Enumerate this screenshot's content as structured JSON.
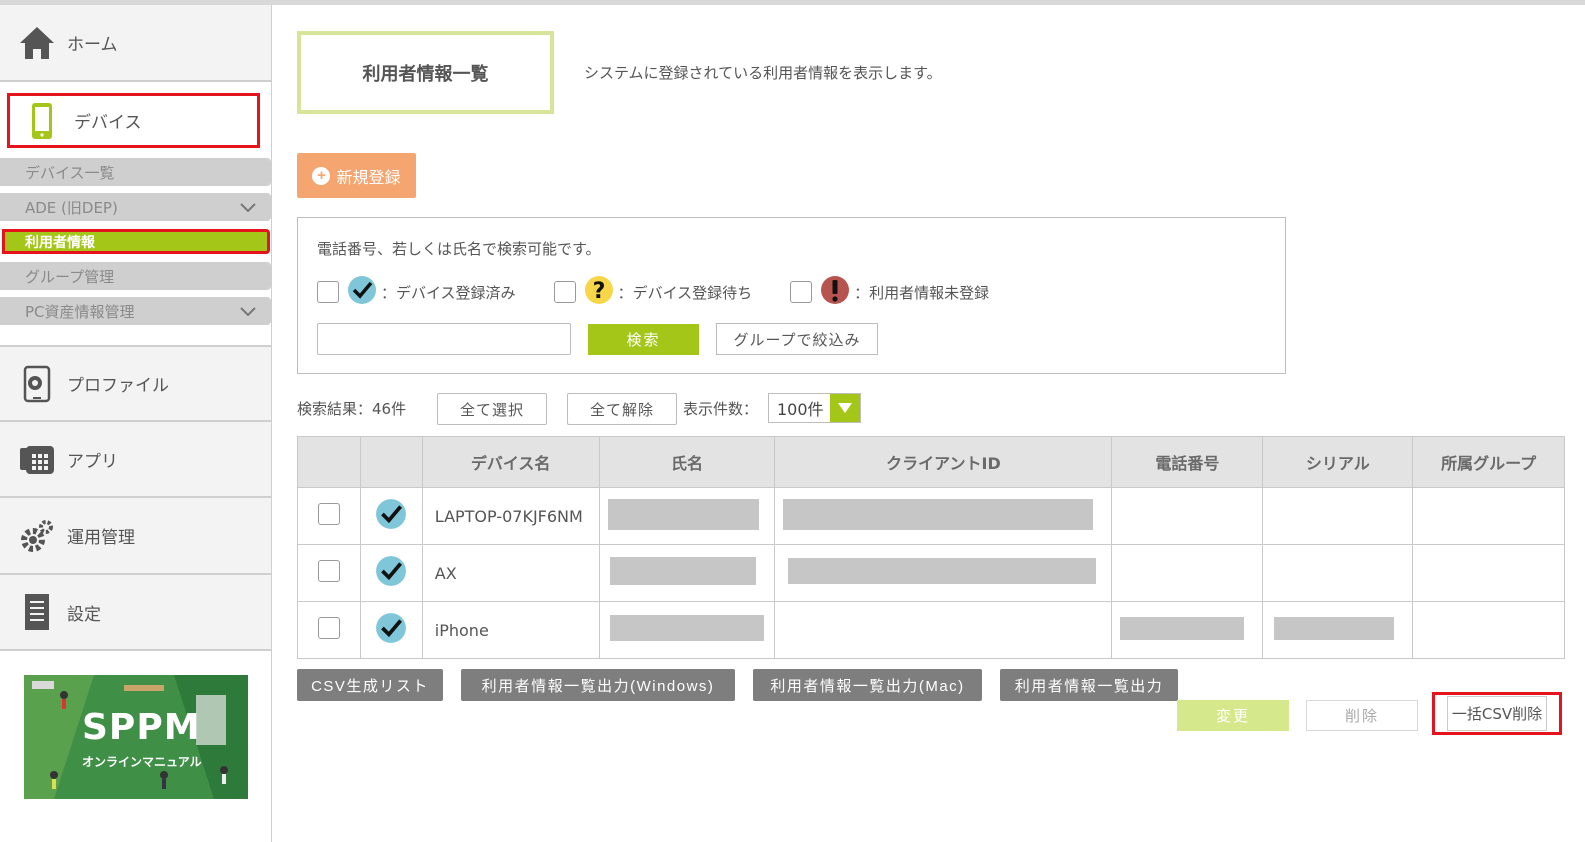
{
  "sidebar": {
    "home": "ホーム",
    "device": "デバイス",
    "sub": [
      {
        "label": "デバイス一覧",
        "expand": false
      },
      {
        "label": "ADE (旧DEP)",
        "expand": true
      },
      {
        "label": "利用者情報",
        "expand": false,
        "active": true
      },
      {
        "label": "グループ管理",
        "expand": false
      },
      {
        "label": "PC資産情報管理",
        "expand": true
      }
    ],
    "profile": "プロファイル",
    "app": "アプリ",
    "ops": "運用管理",
    "settings": "設定",
    "banner": {
      "logo": "SPPM",
      "caption": "オンラインマニュアル"
    }
  },
  "page": {
    "title": "利用者情報一覧",
    "description": "システムに登録されている利用者情報を表示します。",
    "new_button": "新規登録"
  },
  "search": {
    "hint": "電話番号、若しくは氏名で検索可能です。",
    "legend": [
      {
        "icon": "check-icon",
        "label": "：デバイス登録済み"
      },
      {
        "icon": "question-icon",
        "label": "：デバイス登録待ち"
      },
      {
        "icon": "exclamation-icon",
        "label": "：利用者情報未登録"
      }
    ],
    "input_value": "",
    "search_button": "検索",
    "group_button": "グループで絞込み"
  },
  "results": {
    "count_label": "検索結果：46件",
    "select_all": "全て選択",
    "deselect_all": "全て解除",
    "display_label": "表示件数：",
    "display_value": "100件"
  },
  "table": {
    "headers": [
      "",
      "",
      "デバイス名",
      "氏名",
      "クライアントID",
      "電話番号",
      "シリアル",
      "所属グループ"
    ],
    "rows": [
      {
        "device": "LAPTOP-07KJF6NM"
      },
      {
        "device": "AX"
      },
      {
        "device": "iPhone"
      }
    ]
  },
  "bottom": {
    "csv_list": "CSV生成リスト",
    "export_windows": "利用者情報一覧出力(Windows)",
    "export_mac": "利用者情報一覧出力(Mac)",
    "export": "利用者情報一覧出力",
    "change": "変更",
    "delete": "削除",
    "bulk_delete": "一括CSV削除"
  },
  "colors": {
    "accent": "#a3c619",
    "orange": "#f5a56f",
    "highlight": "#e5141c",
    "gray_button": "#7e7e7e"
  }
}
